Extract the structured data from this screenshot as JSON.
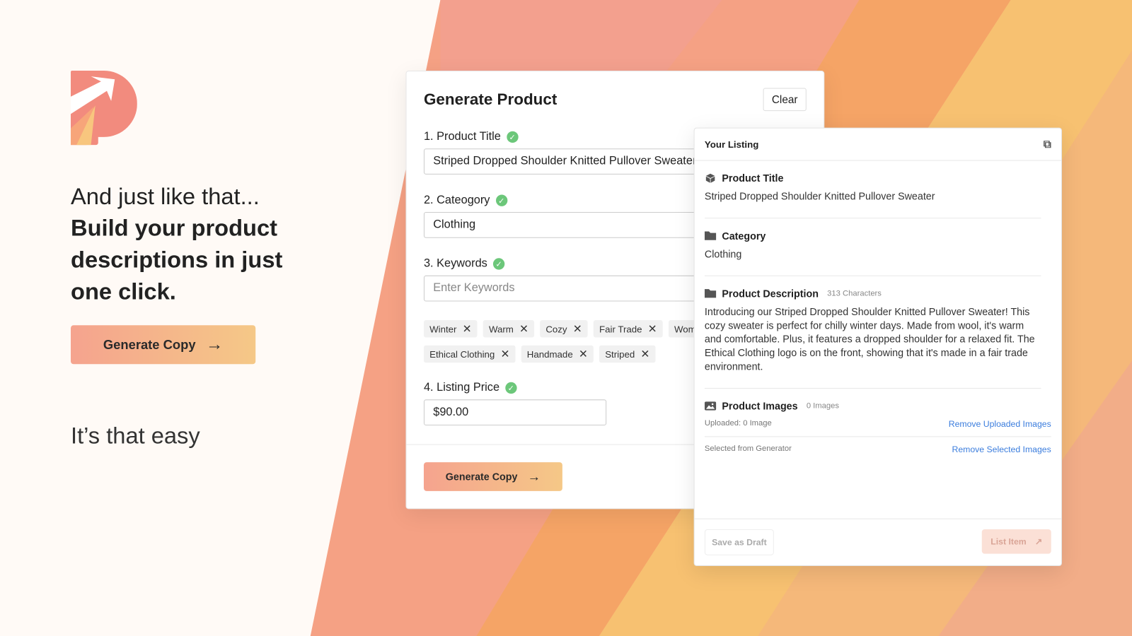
{
  "colors": {
    "accent_start": "#f5a38e",
    "accent_end": "#f5c887",
    "logo": "#f28b7e",
    "link": "#3b7ddd",
    "check": "#6cc77a"
  },
  "hero": {
    "line1": "And just like that...",
    "line2": "Build your product descriptions in just one click.",
    "cta": "Generate Copy",
    "tagline": "It’s that easy"
  },
  "generator": {
    "title": "Generate Product",
    "clear": "Clear",
    "fields": [
      {
        "label": "1. Product Title",
        "value": "Striped Dropped Shoulder Knitted Pullover Sweater"
      },
      {
        "label": "2. Cateogory",
        "value": "Clothing"
      },
      {
        "label": "3. Keywords",
        "placeholder": "Enter Keywords"
      },
      {
        "label": "4. Listing Price",
        "value": "$90.00"
      }
    ],
    "tags_row1": [
      "Winter",
      "Warm",
      "Cozy",
      "Fair Trade",
      "Women"
    ],
    "tags_row2": [
      "Ethical Clothing",
      "Handmade",
      "Striped"
    ],
    "submit": "Generate Copy"
  },
  "listing": {
    "title": "Your Listing",
    "product_title": {
      "heading": "Product Title",
      "value": "Striped Dropped Shoulder Knitted Pullover Sweater"
    },
    "category": {
      "heading": "Category",
      "value": "Clothing"
    },
    "description": {
      "heading": "Product Description",
      "count": "313 Characters",
      "value": "Introducing our Striped Dropped Shoulder Knitted Pullover Sweater! This cozy sweater is perfect for chilly winter days. Made from wool, it's warm and comfortable. Plus, it features a dropped shoulder for a relaxed fit. The Ethical Clothing logo is on the front, showing that it's made in a fair trade environment."
    },
    "images": {
      "heading": "Product Images",
      "count": "0 Images",
      "uploaded": "Uploaded: 0 Image",
      "remove_uploaded": "Remove Uploaded Images",
      "selected": "Selected from Generator",
      "remove_selected": "Remove Selected Images"
    },
    "save_draft": "Save as Draft",
    "list_item": "List Item"
  }
}
